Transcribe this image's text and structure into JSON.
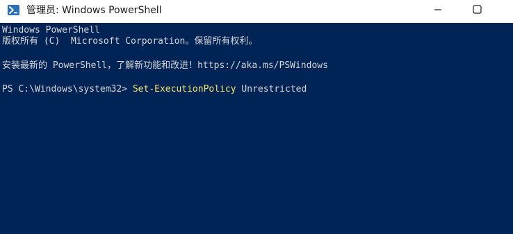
{
  "window": {
    "title": "管理员: Windows PowerShell",
    "controls": {
      "minimize_icon": "minimize-icon",
      "maximize_icon": "maximize-icon"
    }
  },
  "console": {
    "background": "#012456",
    "text_color": "#d8d8d8",
    "command_color": "#f5e56b",
    "lines": [
      "Windows PowerShell",
      "版权所有 (C)  Microsoft Corporation。保留所有权利。",
      "安装最新的 PowerShell，了解新功能和改进！https://aka.ms/PSWindows"
    ],
    "prompt": "PS C:\\Windows\\system32> ",
    "command": "Set-ExecutionPolicy",
    "argument": " Unrestricted"
  }
}
